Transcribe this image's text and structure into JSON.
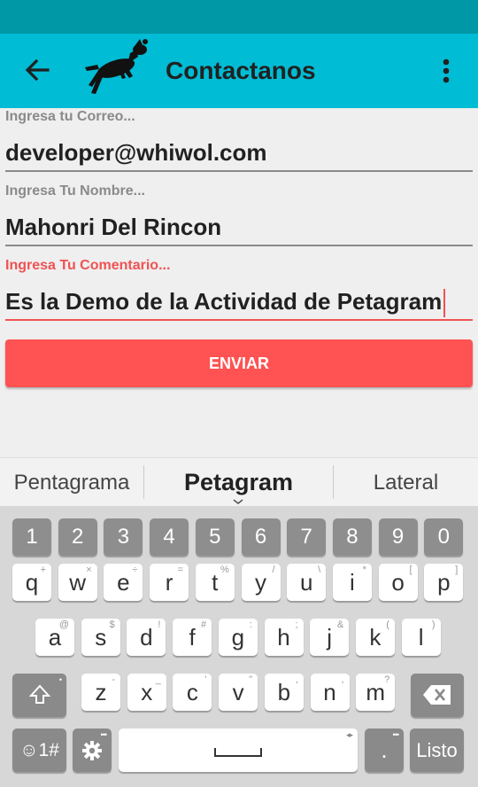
{
  "toolbar": {
    "title": "Contactanos",
    "back_icon": "arrow-back-icon",
    "logo": "dog-logo",
    "menu_icon": "more-vert-icon",
    "color": "#00bcd4",
    "status_color": "#0097a7"
  },
  "form": {
    "email": {
      "label": "Ingresa tu Correo...",
      "value": "developer@whiwol.com"
    },
    "name": {
      "label": "Ingresa Tu Nombre...",
      "value": "Mahonri Del Rincon"
    },
    "comment": {
      "label": "Ingresa Tu Comentario...",
      "value": "Es la Demo de la Actividad de Petagram"
    },
    "accent": "#f05252"
  },
  "send_button": {
    "label": "ENVIAR",
    "color": "#ff5252"
  },
  "suggestions": {
    "left": "Pentagrama",
    "center": "Petagram",
    "right": "Lateral"
  },
  "keyboard": {
    "numbers": [
      "1",
      "2",
      "3",
      "4",
      "5",
      "6",
      "7",
      "8",
      "9",
      "0"
    ],
    "row1": [
      {
        "k": "q",
        "h": "+"
      },
      {
        "k": "w",
        "h": "×"
      },
      {
        "k": "e",
        "h": "÷"
      },
      {
        "k": "r",
        "h": "="
      },
      {
        "k": "t",
        "h": "%"
      },
      {
        "k": "y",
        "h": "/"
      },
      {
        "k": "u",
        "h": "\\"
      },
      {
        "k": "i",
        "h": "*"
      },
      {
        "k": "o",
        "h": "["
      },
      {
        "k": "p",
        "h": "]"
      }
    ],
    "row2": [
      {
        "k": "a",
        "h": "@"
      },
      {
        "k": "s",
        "h": "$"
      },
      {
        "k": "d",
        "h": "!"
      },
      {
        "k": "f",
        "h": "#"
      },
      {
        "k": "g",
        "h": ":"
      },
      {
        "k": "h",
        "h": ";"
      },
      {
        "k": "j",
        "h": "&"
      },
      {
        "k": "k",
        "h": "("
      },
      {
        "k": "l",
        "h": ")"
      }
    ],
    "row3": [
      {
        "k": "z",
        "h": "-"
      },
      {
        "k": "x",
        "h": "_"
      },
      {
        "k": "c",
        "h": "'"
      },
      {
        "k": "v",
        "h": "\""
      },
      {
        "k": "b",
        "h": ","
      },
      {
        "k": "n",
        "h": ","
      },
      {
        "k": "m",
        "h": "?"
      }
    ],
    "symbols_key": "☺1#",
    "period_key": ".",
    "done_key": "Listo",
    "shift_icon": "shift-icon",
    "backspace_icon": "backspace-icon",
    "settings_icon": "gear-icon",
    "space_icon": "space-icon"
  }
}
